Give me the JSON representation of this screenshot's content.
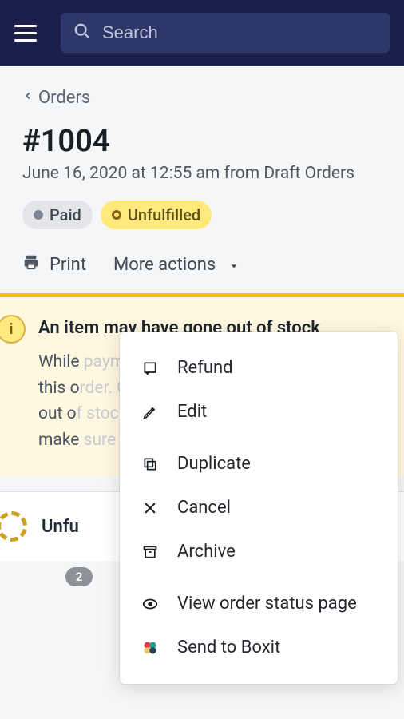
{
  "topbar": {
    "search_placeholder": "Search"
  },
  "breadcrumb": {
    "back_label": "Orders"
  },
  "order": {
    "title": "#1004",
    "subtitle": "June 16, 2020 at 12:55 am from Draft Orders"
  },
  "badges": {
    "paid": "Paid",
    "unfulfilled": "Unfulfilled"
  },
  "actions": {
    "print": "Print",
    "more": "More actions"
  },
  "dropdown": {
    "refund": "Refund",
    "edit": "Edit",
    "duplicate": "Duplicate",
    "cancel": "Cancel",
    "archive": "Archive",
    "view_status": "View order status page",
    "send_boxit": "Send to Boxit"
  },
  "alert": {
    "title_line1": "An item may have gone out of",
    "title_line2": "stock",
    "body_visible_prefix": "While",
    "body_faded_1": "payment was being processed for",
    "body_line2_prefix": "this o",
    "body_faded_2": "rder. One item may have gone",
    "body_line3_prefix": "out o",
    "body_faded_3": "f stock. Before you fulfill this order",
    "body_line4_prefix": "make",
    "body_faded_4": " sure you have this item in stock."
  },
  "fulfillment": {
    "label_prefix": "Unfu",
    "count": "2"
  }
}
